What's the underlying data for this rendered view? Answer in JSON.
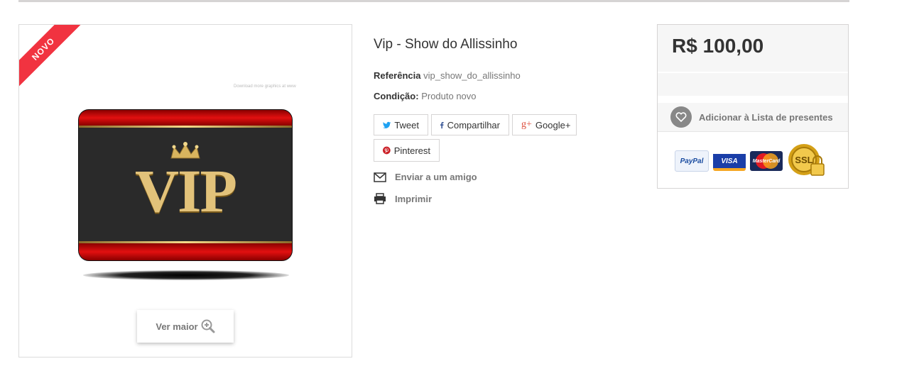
{
  "product": {
    "badge": "NOVO",
    "image_note": "Download more graphics at www",
    "image_text": "VIP",
    "zoom_label": "Ver maior",
    "title": "Vip - Show do Allissinho",
    "reference_label": "Referência",
    "reference_value": "vip_show_do_allissinho",
    "condition_label": "Condição:",
    "condition_value": "Produto novo"
  },
  "share": {
    "tweet": "Tweet",
    "facebook": "Compartilhar",
    "google": "Google+",
    "pinterest": "Pinterest"
  },
  "actions": {
    "send_friend": "Enviar a um amigo",
    "print": "Imprimir"
  },
  "buy_box": {
    "price": "R$ 100,00",
    "wishlist": "Adicionar à Lista de presentes",
    "payments": [
      "PayPal",
      "VISA",
      "MasterCard",
      "SSL"
    ]
  },
  "colors": {
    "badge": "#f13340",
    "twitter": "#1da1f2",
    "facebook": "#3b5998",
    "google": "#dd4b39",
    "pinterest": "#cb2027"
  }
}
